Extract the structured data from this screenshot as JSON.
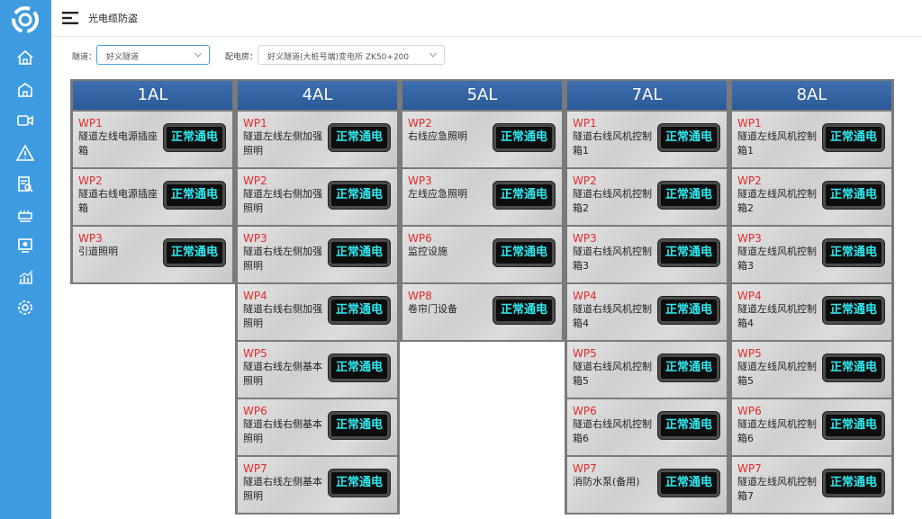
{
  "header": {
    "title": "光电缆防盗"
  },
  "filters": {
    "tunnel_label": "隧道：",
    "tunnel_value": "好义隧道",
    "room_label": "配电房：",
    "room_value": "好义隧道(大桩号端)变电所 ZK50+200"
  },
  "sidebar": {
    "items": [
      "home-icon",
      "building-icon",
      "video-icon",
      "warning-icon",
      "report-icon",
      "device-icon",
      "monitor-icon",
      "chart-icon",
      "settings-icon"
    ]
  },
  "status_color": "#2fe9f0",
  "code_color": "#e22b2b",
  "columns": [
    {
      "title": "1AL",
      "cards": [
        {
          "code": "WP1",
          "name": "隧道左线电源插座箱",
          "status": "正常通电"
        },
        {
          "code": "WP2",
          "name": "隧道右线电源插座箱",
          "status": "正常通电"
        },
        {
          "code": "WP3",
          "name": "引道照明",
          "status": "正常通电"
        }
      ]
    },
    {
      "title": "4AL",
      "cards": [
        {
          "code": "WP1",
          "name": "隧道左线左侧加强照明",
          "status": "正常通电"
        },
        {
          "code": "WP2",
          "name": "隧道左线右侧加强照明",
          "status": "正常通电"
        },
        {
          "code": "WP3",
          "name": "隧道右线左侧加强照明",
          "status": "正常通电"
        },
        {
          "code": "WP4",
          "name": "隧道右线右侧加强照明",
          "status": "正常通电"
        },
        {
          "code": "WP5",
          "name": "隧道右线左侧基本照明",
          "status": "正常通电"
        },
        {
          "code": "WP6",
          "name": "隧道右线右侧基本照明",
          "status": "正常通电"
        },
        {
          "code": "WP7",
          "name": "隧道右线左侧基本照明",
          "status": "正常通电"
        }
      ]
    },
    {
      "title": "5AL",
      "cards": [
        {
          "code": "WP2",
          "name": "右线应急照明",
          "status": "正常通电"
        },
        {
          "code": "WP3",
          "name": "左线应急照明",
          "status": "正常通电"
        },
        {
          "code": "WP6",
          "name": "监控设施",
          "status": "正常通电"
        },
        {
          "code": "WP8",
          "name": "卷帘门设备",
          "status": "正常通电"
        }
      ]
    },
    {
      "title": "7AL",
      "cards": [
        {
          "code": "WP1",
          "name": "隧道右线风机控制箱1",
          "status": "正常通电"
        },
        {
          "code": "WP2",
          "name": "隧道右线风机控制箱2",
          "status": "正常通电"
        },
        {
          "code": "WP3",
          "name": "隧道右线风机控制箱3",
          "status": "正常通电"
        },
        {
          "code": "WP4",
          "name": "隧道右线风机控制箱4",
          "status": "正常通电"
        },
        {
          "code": "WP5",
          "name": "隧道右线风机控制箱5",
          "status": "正常通电"
        },
        {
          "code": "WP6",
          "name": "隧道右线风机控制箱6",
          "status": "正常通电"
        },
        {
          "code": "WP7",
          "name": "消防水泵(备用)",
          "status": "正常通电"
        }
      ]
    },
    {
      "title": "8AL",
      "cards": [
        {
          "code": "WP1",
          "name": "隧道左线风机控制箱1",
          "status": "正常通电"
        },
        {
          "code": "WP2",
          "name": "隧道左线风机控制箱2",
          "status": "正常通电"
        },
        {
          "code": "WP3",
          "name": "隧道左线风机控制箱3",
          "status": "正常通电"
        },
        {
          "code": "WP4",
          "name": "隧道左线风机控制箱4",
          "status": "正常通电"
        },
        {
          "code": "WP5",
          "name": "隧道左线风机控制箱5",
          "status": "正常通电"
        },
        {
          "code": "WP6",
          "name": "隧道左线风机控制箱6",
          "status": "正常通电"
        },
        {
          "code": "WP7",
          "name": "隧道左线风机控制箱7",
          "status": "正常通电"
        }
      ]
    }
  ]
}
